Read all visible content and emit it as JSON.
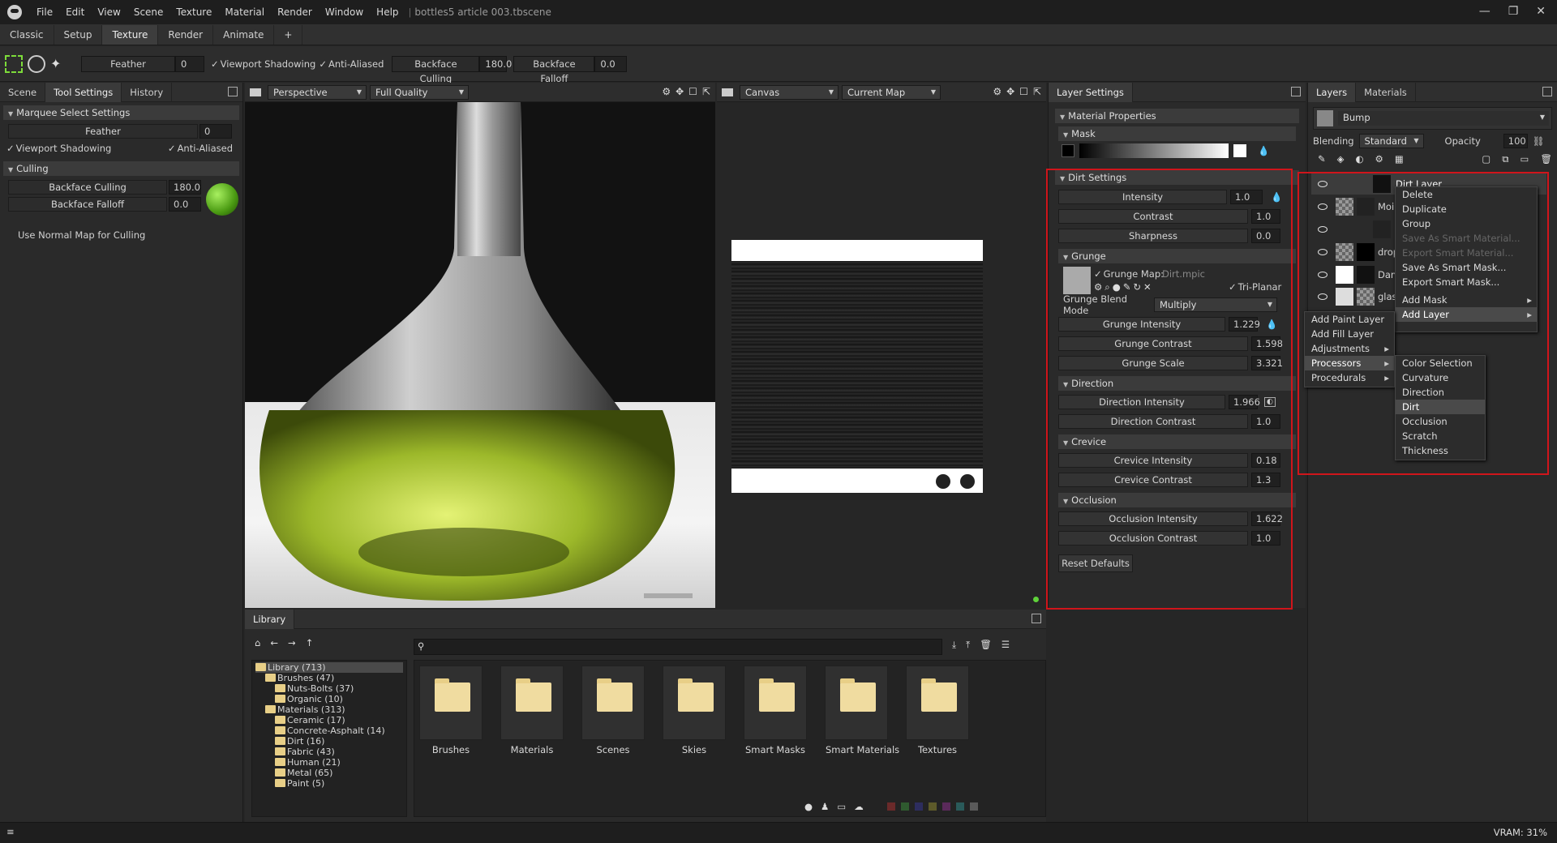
{
  "menu": [
    "File",
    "Edit",
    "View",
    "Scene",
    "Texture",
    "Material",
    "Render",
    "Window",
    "Help"
  ],
  "doc_title": "bottles5 article 003.tbscene",
  "window_controls": [
    "—",
    "❐",
    "✕"
  ],
  "workspace_tabs": [
    "Classic",
    "Setup",
    "Texture",
    "Render",
    "Animate",
    "+"
  ],
  "toolbar": {
    "feather_label": "Feather",
    "feather_value": "0",
    "viewport_shadowing": "Viewport Shadowing",
    "anti_aliased": "Anti-Aliased",
    "backface_culling": "Backface Culling",
    "backface_culling_value": "180.0",
    "backface_falloff": "Backface Falloff",
    "backface_falloff_value": "0.0"
  },
  "left_panel": {
    "tabs": [
      "Scene",
      "Tool Settings",
      "History"
    ],
    "section1": "Marquee Select Settings",
    "feather": "Feather",
    "feather_value": "0",
    "viewport_shadowing": "Viewport Shadowing",
    "anti_aliased": "Anti-Aliased",
    "section2": "Culling",
    "backface_culling": "Backface Culling",
    "backface_culling_value": "180.0",
    "backface_falloff": "Backface Falloff",
    "backface_falloff_value": "0.0",
    "use_normal_map": "Use Normal Map for Culling"
  },
  "viewport": {
    "camera": "Perspective",
    "quality": "Full Quality"
  },
  "canvas_view": {
    "mode": "Canvas",
    "map": "Current Map"
  },
  "layer_settings": {
    "title": "Layer Settings",
    "material_properties": "Material Properties",
    "mask": "Mask",
    "dirt_settings": "Dirt Settings",
    "intensity": "Intensity",
    "intensity_value": "1.0",
    "contrast": "Contrast",
    "contrast_value": "1.0",
    "sharpness": "Sharpness",
    "sharpness_value": "0.0",
    "grunge": "Grunge",
    "grunge_map_label": "Grunge Map:",
    "grunge_map_value": "Dirt.mpic",
    "tri_planar": "Tri-Planar",
    "grunge_blend_mode": "Grunge Blend Mode",
    "grunge_blend_value": "Multiply",
    "grunge_intensity": "Grunge Intensity",
    "grunge_intensity_value": "1.229",
    "grunge_contrast": "Grunge Contrast",
    "grunge_contrast_value": "1.598",
    "grunge_scale": "Grunge Scale",
    "grunge_scale_value": "3.321",
    "direction": "Direction",
    "direction_intensity": "Direction Intensity",
    "direction_intensity_value": "1.966",
    "direction_contrast": "Direction Contrast",
    "direction_contrast_value": "1.0",
    "crevice": "Crevice",
    "crevice_intensity": "Crevice Intensity",
    "crevice_intensity_value": "0.18",
    "crevice_contrast": "Crevice Contrast",
    "crevice_contrast_value": "1.3",
    "occlusion": "Occlusion",
    "occlusion_intensity": "Occlusion Intensity",
    "occlusion_intensity_value": "1.622",
    "occlusion_contrast": "Occlusion Contrast",
    "occlusion_contrast_value": "1.0",
    "reset": "Reset Defaults"
  },
  "layers": {
    "tabs": [
      "Layers",
      "Materials"
    ],
    "channel": "Bump",
    "blending_label": "Blending",
    "blending_value": "Standard",
    "opacity_label": "Opacity",
    "opacity_value": "100",
    "rows": [
      "Dirt Layer",
      "Moi",
      "",
      "drop",
      "Dam",
      "glas"
    ]
  },
  "context_menu": {
    "items": [
      "Delete",
      "Duplicate",
      "Group",
      "Save As Smart Material...",
      "Export Smart Material...",
      "Save As Smart Mask...",
      "Export Smart Mask...",
      "Add Mask",
      "Add Layer"
    ]
  },
  "add_layer_menu": {
    "items": [
      "Add Paint Layer",
      "Add Fill Layer",
      "Adjustments",
      "Processors",
      "Procedurals"
    ]
  },
  "processors_menu": {
    "items": [
      "Color Selection",
      "Curvature",
      "Direction",
      "Dirt",
      "Occlusion",
      "Scratch",
      "Thickness"
    ]
  },
  "library": {
    "title": "Library",
    "tree": [
      "Library (713)",
      "Brushes (47)",
      "Nuts-Bolts (37)",
      "Organic (10)",
      "Materials (313)",
      "Ceramic (17)",
      "Concrete-Asphalt (14)",
      "Dirt (16)",
      "Fabric (43)",
      "Human (21)",
      "Metal (65)",
      "Paint (5)"
    ],
    "folders": [
      "Brushes",
      "Materials",
      "Scenes",
      "Skies",
      "Smart Masks",
      "Smart Materials",
      "Textures"
    ],
    "swatch_colors": [
      "#6a2a2a",
      "#2f5a2f",
      "#2d2d5e",
      "#5d5a2a",
      "#5a2a5a",
      "#2a5a5a",
      "#5a5a5a"
    ]
  },
  "status": {
    "vram": "VRAM: 31%"
  }
}
